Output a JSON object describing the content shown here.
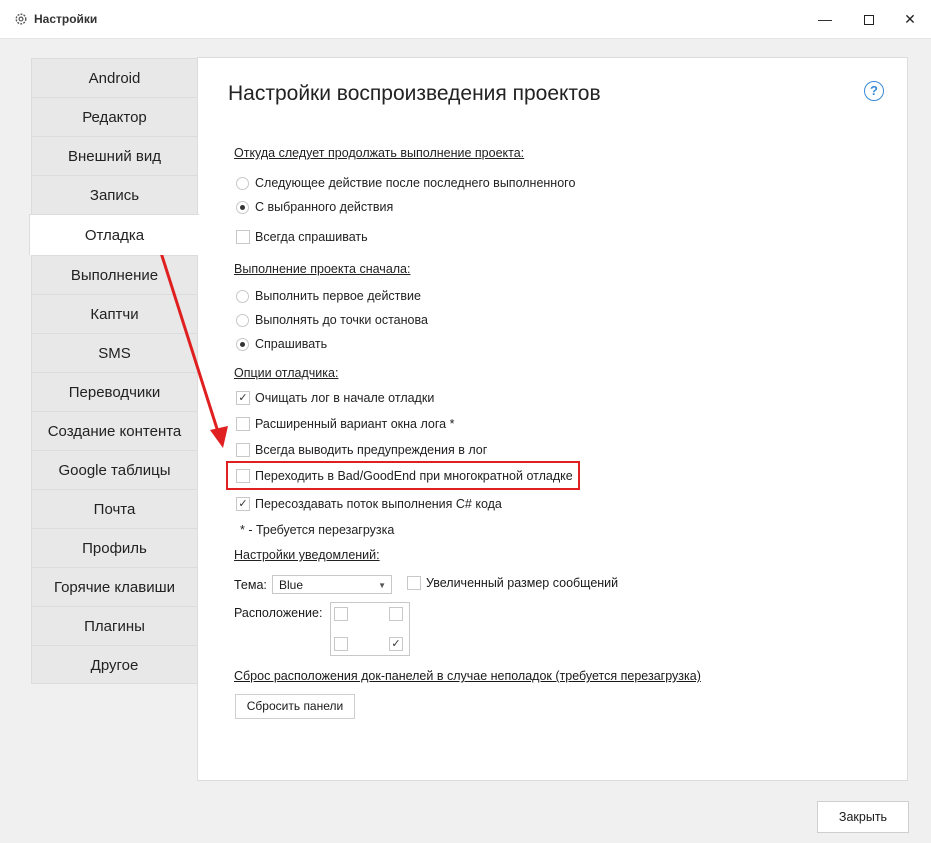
{
  "window": {
    "title": "Настройки",
    "minimize": "—",
    "close": "✕"
  },
  "sidebar": {
    "items": [
      {
        "label": "Android"
      },
      {
        "label": "Редактор"
      },
      {
        "label": "Внешний вид"
      },
      {
        "label": "Запись"
      },
      {
        "label": "Отладка",
        "active": true
      },
      {
        "label": "Выполнение"
      },
      {
        "label": "Каптчи"
      },
      {
        "label": "SMS"
      },
      {
        "label": "Переводчики"
      },
      {
        "label": "Создание контента"
      },
      {
        "label": "Google таблицы"
      },
      {
        "label": "Почта"
      },
      {
        "label": "Профиль"
      },
      {
        "label": "Горячие клавиши"
      },
      {
        "label": "Плагины"
      },
      {
        "label": "Другое"
      }
    ]
  },
  "panel": {
    "title": "Настройки воспроизведения проектов",
    "help": "?",
    "continue_section": {
      "label": "Откуда следует продолжать выполнение проекта:",
      "options": [
        {
          "label": "Следующее действие после последнего выполненного",
          "selected": false
        },
        {
          "label": "С выбранного действия",
          "selected": true
        }
      ],
      "always_ask": {
        "label": "Всегда спрашивать",
        "checked": false
      }
    },
    "start_section": {
      "label": "Выполнение проекта сначала:",
      "options": [
        {
          "label": "Выполнить первое действие",
          "selected": false
        },
        {
          "label": "Выполнять до точки останова",
          "selected": false
        },
        {
          "label": "Спрашивать",
          "selected": true
        }
      ]
    },
    "debugger_section": {
      "label": "Опции отладчика:",
      "options": [
        {
          "label": "Очищать лог в начале отладки",
          "checked": true
        },
        {
          "label": "Расширенный вариант окна лога *",
          "checked": false
        },
        {
          "label": "Всегда выводить предупреждения в лог",
          "checked": false
        },
        {
          "label": "Переходить в Bad/GoodEnd при многократной отладке",
          "checked": false
        },
        {
          "label": "Пересоздавать поток выполнения C# кода",
          "checked": true
        }
      ],
      "note": "* - Требуется перезагрузка"
    },
    "notifications": {
      "label": "Настройки уведомлений:",
      "theme_label": "Тема:",
      "theme_value": "Blue",
      "big_messages": {
        "label": "Увеличенный размер сообщений",
        "checked": false
      },
      "position_label": "Расположение:",
      "position_checked": "bottom-right",
      "check_mark": "✓"
    },
    "reset": {
      "link": "Сброс расположения док-панелей в случае неполадок (требуется перезагрузка)",
      "button": "Сбросить панели"
    }
  },
  "footer": {
    "close_button": "Закрыть"
  },
  "colors": {
    "highlight": "#e02020",
    "accent": "#3a8ad6"
  }
}
